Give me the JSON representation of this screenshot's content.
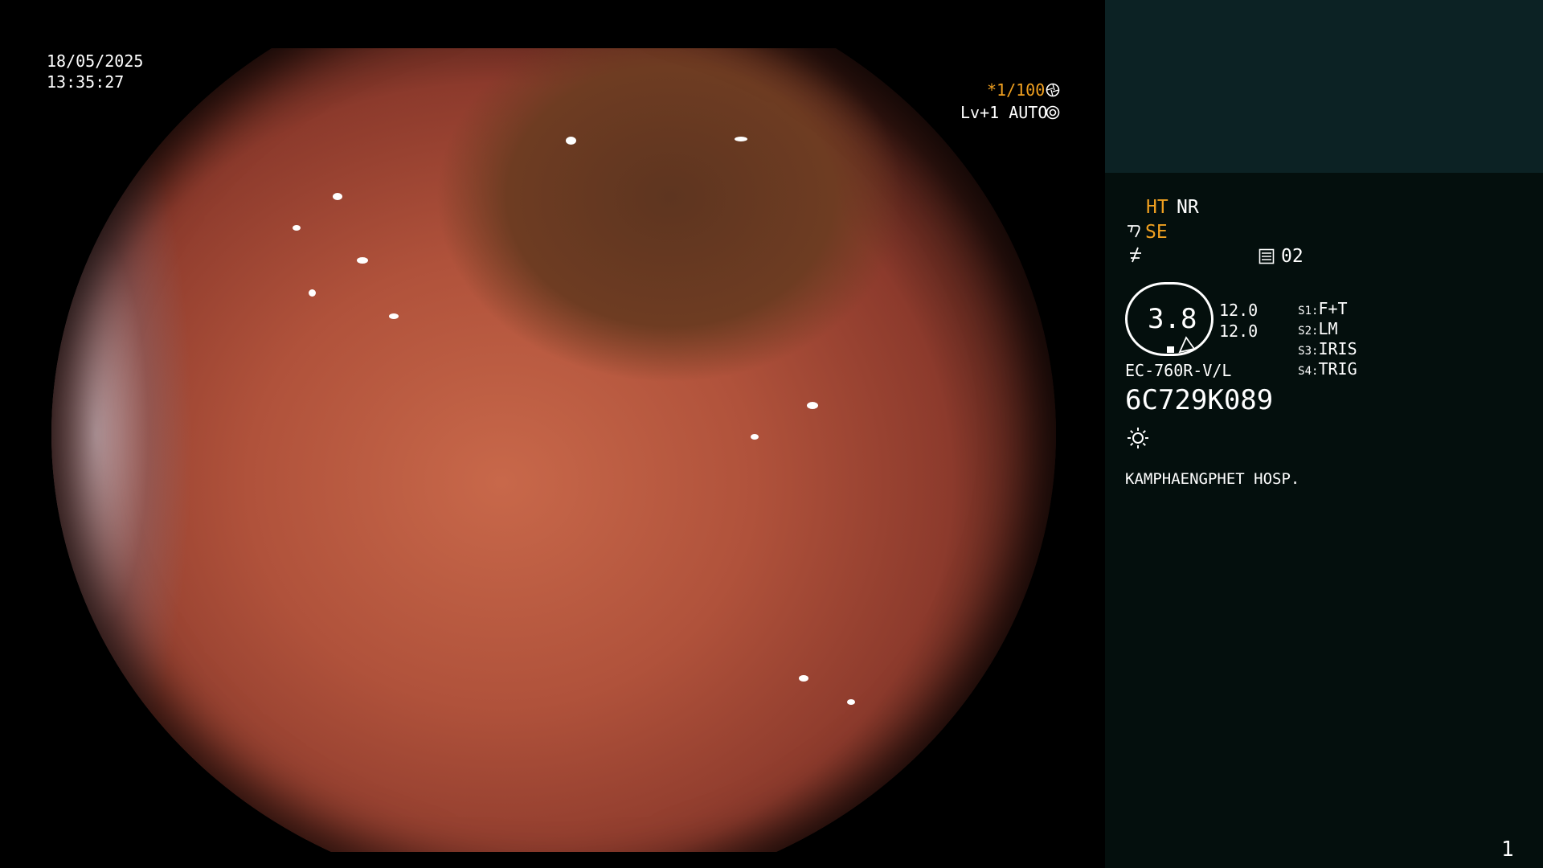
{
  "scope": {
    "date": "18/05/2025",
    "time": "13:35:27",
    "shutter": "*1/100",
    "level": "Lv+1 AUTO"
  },
  "panel": {
    "ht": "HT",
    "nr": "NR",
    "se": "SE",
    "memory": "02",
    "gauge_value": "3.8",
    "gauge_side_1": "12.0",
    "gauge_side_2": "12.0",
    "switches": [
      {
        "key": "S1",
        "value": "F+T"
      },
      {
        "key": "S2",
        "value": "LM"
      },
      {
        "key": "S3",
        "value": "IRIS"
      },
      {
        "key": "S4",
        "value": "TRIG"
      }
    ],
    "model": "EC-760R-V/L",
    "serial": "6C729K089",
    "hospital": "KAMPHAENGPHET HOSP.",
    "page_number": "1"
  },
  "colors": {
    "accent": "#f0a020",
    "panel_bg": "#040f0d",
    "panel_top_bg": "#0c2224"
  },
  "icons": [
    "aperture-icon",
    "target-icon",
    "scope-tip-icon",
    "freeze-icon",
    "memory-icon",
    "light-icon"
  ]
}
